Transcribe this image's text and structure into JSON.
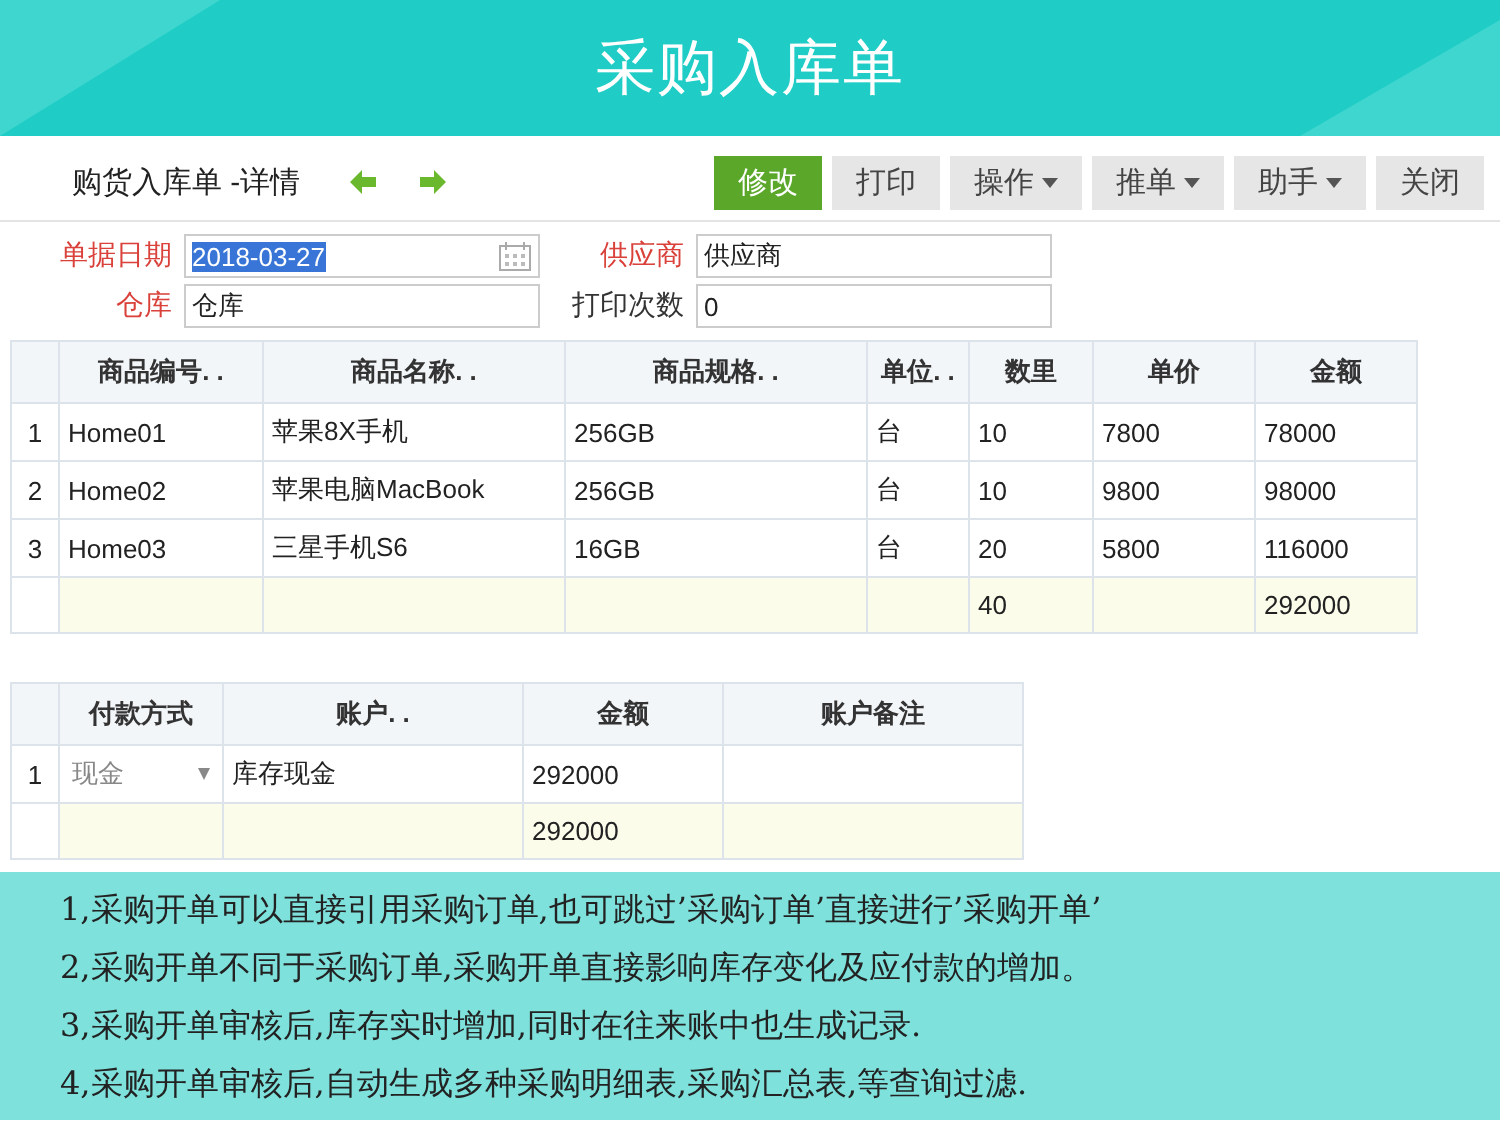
{
  "banner": {
    "title": "采购入库单"
  },
  "toolbar": {
    "title": "购货入库单 -详情",
    "buttons": [
      {
        "label": "修改",
        "kind": "primary",
        "dropdown": false
      },
      {
        "label": "打印",
        "kind": "normal",
        "dropdown": false
      },
      {
        "label": "操作",
        "kind": "normal",
        "dropdown": true
      },
      {
        "label": "推单",
        "kind": "normal",
        "dropdown": true
      },
      {
        "label": "助手",
        "kind": "normal",
        "dropdown": true
      },
      {
        "label": "关闭",
        "kind": "normal",
        "dropdown": false
      }
    ]
  },
  "form": [
    {
      "label": "单据日期",
      "value": "2018-03-27",
      "required": true,
      "kind": "date",
      "text_selected": true
    },
    {
      "label": "供应商",
      "value": "供应商",
      "required": true,
      "kind": "text",
      "text_selected": false
    },
    {
      "label": "仓库",
      "value": "仓库",
      "required": true,
      "kind": "text",
      "text_selected": false
    },
    {
      "label": "打印次数",
      "value": "0",
      "required": false,
      "kind": "text",
      "text_selected": false
    }
  ],
  "items_table": {
    "columns": [
      "商品编号. .",
      "商品名称. .",
      "商品规格. .",
      "单位. .",
      "数里",
      "单价",
      "金额"
    ],
    "rows": [
      {
        "index": "1",
        "cells": [
          "Home01",
          "苹果8X手机",
          "256GB",
          "台",
          "10",
          "7800",
          "78000"
        ]
      },
      {
        "index": "2",
        "cells": [
          "Home02",
          "苹果电脑MacBook",
          "256GB",
          "台",
          "10",
          "9800",
          "98000"
        ]
      },
      {
        "index": "3",
        "cells": [
          "Home03",
          "三星手机S6",
          "16GB",
          "台",
          "20",
          "5800",
          "116000"
        ]
      }
    ],
    "totals": {
      "quantity": "40",
      "amount": "292000"
    }
  },
  "payment_table": {
    "columns": [
      "付款方式",
      "账户. .",
      "金额",
      "账户备注"
    ],
    "rows": [
      {
        "index": "1",
        "cells": [
          "现金",
          "库存现金",
          "292000"
        ]
      }
    ],
    "totals": {
      "amount": "292000"
    }
  },
  "notes": [
    "1,采购开单可以直接引用采购订单,也可跳过’采购订单’直接进行’采购开单’",
    "2,采购开单不同于采购订单,采购开单直接影响库存变化及应付款的增加。",
    "3,采购开单审核后,库存实时增加,同时在往来账中也生成记录.",
    "4,采购开单审核后,自动生成多种采购明细表,采购汇总表,等查询过滤."
  ]
}
